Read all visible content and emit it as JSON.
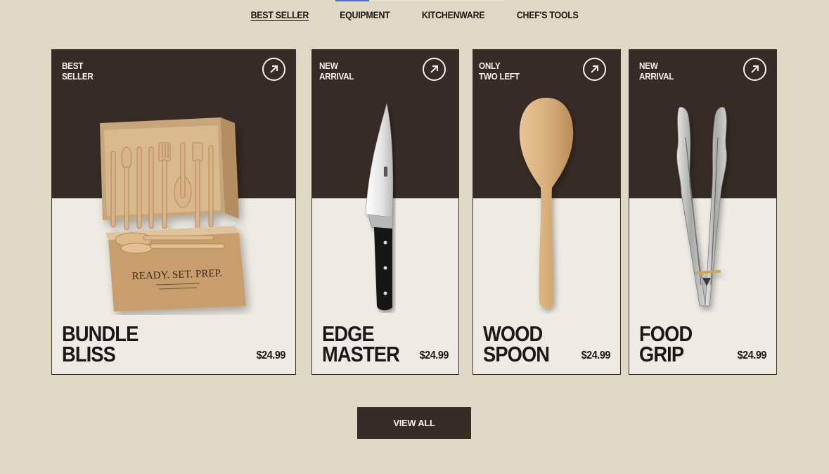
{
  "nav": {
    "tabs": [
      {
        "label": "BEST SELLER",
        "active": true
      },
      {
        "label": "EQUIPMENT",
        "active": false
      },
      {
        "label": "KITCHENWARE",
        "active": false
      },
      {
        "label": "CHEF'S TOOLS",
        "active": false
      }
    ]
  },
  "products": [
    {
      "badge": "BEST\nSELLER",
      "name_line1": "BUNDLE",
      "name_line2": "BLISS",
      "price": "$24.99",
      "icon": "arrow-up-right-icon",
      "image": "utensil-set-box-image",
      "box_text": "READY. SET. PREP."
    },
    {
      "badge": "NEW\nARRIVAL",
      "name_line1": "EDGE",
      "name_line2": "MASTER",
      "price": "$24.99",
      "icon": "arrow-up-right-icon",
      "image": "chef-knife-image"
    },
    {
      "badge": "ONLY\nTWO LEFT",
      "name_line1": "WOOD",
      "name_line2": "SPOON",
      "price": "$24.99",
      "icon": "arrow-up-right-icon",
      "image": "wooden-spoon-image"
    },
    {
      "badge": "NEW\nARRIVAL",
      "name_line1": "FOOD",
      "name_line2": "GRIP",
      "price": "$24.99",
      "icon": "arrow-up-right-icon",
      "image": "metal-tongs-image"
    }
  ],
  "view_all_label": "VIEW ALL",
  "colors": {
    "background": "#dfd8c4",
    "card_dark": "#372b25",
    "card_light": "#eeebe4",
    "text": "#1d1814"
  }
}
